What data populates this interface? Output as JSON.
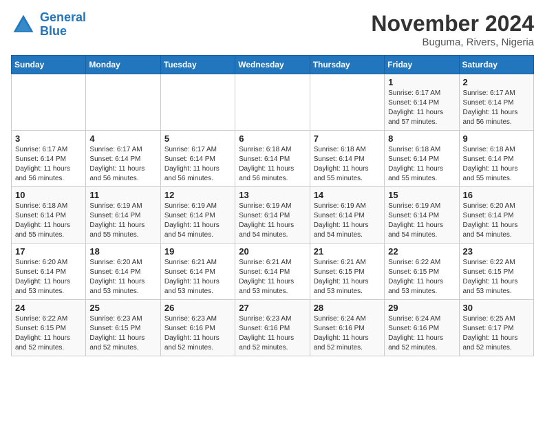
{
  "logo": {
    "line1": "General",
    "line2": "Blue"
  },
  "title": "November 2024",
  "location": "Buguma, Rivers, Nigeria",
  "weekdays": [
    "Sunday",
    "Monday",
    "Tuesday",
    "Wednesday",
    "Thursday",
    "Friday",
    "Saturday"
  ],
  "rows": [
    [
      {
        "day": "",
        "info": ""
      },
      {
        "day": "",
        "info": ""
      },
      {
        "day": "",
        "info": ""
      },
      {
        "day": "",
        "info": ""
      },
      {
        "day": "",
        "info": ""
      },
      {
        "day": "1",
        "info": "Sunrise: 6:17 AM\nSunset: 6:14 PM\nDaylight: 11 hours\nand 57 minutes."
      },
      {
        "day": "2",
        "info": "Sunrise: 6:17 AM\nSunset: 6:14 PM\nDaylight: 11 hours\nand 56 minutes."
      }
    ],
    [
      {
        "day": "3",
        "info": "Sunrise: 6:17 AM\nSunset: 6:14 PM\nDaylight: 11 hours\nand 56 minutes."
      },
      {
        "day": "4",
        "info": "Sunrise: 6:17 AM\nSunset: 6:14 PM\nDaylight: 11 hours\nand 56 minutes."
      },
      {
        "day": "5",
        "info": "Sunrise: 6:17 AM\nSunset: 6:14 PM\nDaylight: 11 hours\nand 56 minutes."
      },
      {
        "day": "6",
        "info": "Sunrise: 6:18 AM\nSunset: 6:14 PM\nDaylight: 11 hours\nand 56 minutes."
      },
      {
        "day": "7",
        "info": "Sunrise: 6:18 AM\nSunset: 6:14 PM\nDaylight: 11 hours\nand 55 minutes."
      },
      {
        "day": "8",
        "info": "Sunrise: 6:18 AM\nSunset: 6:14 PM\nDaylight: 11 hours\nand 55 minutes."
      },
      {
        "day": "9",
        "info": "Sunrise: 6:18 AM\nSunset: 6:14 PM\nDaylight: 11 hours\nand 55 minutes."
      }
    ],
    [
      {
        "day": "10",
        "info": "Sunrise: 6:18 AM\nSunset: 6:14 PM\nDaylight: 11 hours\nand 55 minutes."
      },
      {
        "day": "11",
        "info": "Sunrise: 6:19 AM\nSunset: 6:14 PM\nDaylight: 11 hours\nand 55 minutes."
      },
      {
        "day": "12",
        "info": "Sunrise: 6:19 AM\nSunset: 6:14 PM\nDaylight: 11 hours\nand 54 minutes."
      },
      {
        "day": "13",
        "info": "Sunrise: 6:19 AM\nSunset: 6:14 PM\nDaylight: 11 hours\nand 54 minutes."
      },
      {
        "day": "14",
        "info": "Sunrise: 6:19 AM\nSunset: 6:14 PM\nDaylight: 11 hours\nand 54 minutes."
      },
      {
        "day": "15",
        "info": "Sunrise: 6:19 AM\nSunset: 6:14 PM\nDaylight: 11 hours\nand 54 minutes."
      },
      {
        "day": "16",
        "info": "Sunrise: 6:20 AM\nSunset: 6:14 PM\nDaylight: 11 hours\nand 54 minutes."
      }
    ],
    [
      {
        "day": "17",
        "info": "Sunrise: 6:20 AM\nSunset: 6:14 PM\nDaylight: 11 hours\nand 53 minutes."
      },
      {
        "day": "18",
        "info": "Sunrise: 6:20 AM\nSunset: 6:14 PM\nDaylight: 11 hours\nand 53 minutes."
      },
      {
        "day": "19",
        "info": "Sunrise: 6:21 AM\nSunset: 6:14 PM\nDaylight: 11 hours\nand 53 minutes."
      },
      {
        "day": "20",
        "info": "Sunrise: 6:21 AM\nSunset: 6:14 PM\nDaylight: 11 hours\nand 53 minutes."
      },
      {
        "day": "21",
        "info": "Sunrise: 6:21 AM\nSunset: 6:15 PM\nDaylight: 11 hours\nand 53 minutes."
      },
      {
        "day": "22",
        "info": "Sunrise: 6:22 AM\nSunset: 6:15 PM\nDaylight: 11 hours\nand 53 minutes."
      },
      {
        "day": "23",
        "info": "Sunrise: 6:22 AM\nSunset: 6:15 PM\nDaylight: 11 hours\nand 53 minutes."
      }
    ],
    [
      {
        "day": "24",
        "info": "Sunrise: 6:22 AM\nSunset: 6:15 PM\nDaylight: 11 hours\nand 52 minutes."
      },
      {
        "day": "25",
        "info": "Sunrise: 6:23 AM\nSunset: 6:15 PM\nDaylight: 11 hours\nand 52 minutes."
      },
      {
        "day": "26",
        "info": "Sunrise: 6:23 AM\nSunset: 6:16 PM\nDaylight: 11 hours\nand 52 minutes."
      },
      {
        "day": "27",
        "info": "Sunrise: 6:23 AM\nSunset: 6:16 PM\nDaylight: 11 hours\nand 52 minutes."
      },
      {
        "day": "28",
        "info": "Sunrise: 6:24 AM\nSunset: 6:16 PM\nDaylight: 11 hours\nand 52 minutes."
      },
      {
        "day": "29",
        "info": "Sunrise: 6:24 AM\nSunset: 6:16 PM\nDaylight: 11 hours\nand 52 minutes."
      },
      {
        "day": "30",
        "info": "Sunrise: 6:25 AM\nSunset: 6:17 PM\nDaylight: 11 hours\nand 52 minutes."
      }
    ]
  ]
}
